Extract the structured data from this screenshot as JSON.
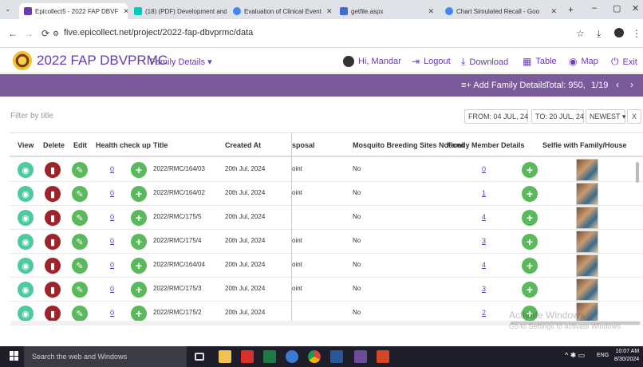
{
  "browser": {
    "tabs": [
      {
        "label": "Epicollect5 - 2022 FAP DBVF",
        "color": "#6a3ab0",
        "active": true
      },
      {
        "label": "(18) (PDF) Development and",
        "color": "#00ccbb",
        "active": false
      },
      {
        "label": "Evaluation of Clinical Event",
        "color": "#4285f4",
        "active": false
      },
      {
        "label": "getfile.aspx",
        "color": "#3f6bd6",
        "active": false
      },
      {
        "label": "Chart Simulated Recall - Goo",
        "color": "#4285f4",
        "active": false
      }
    ],
    "new_tab": "+",
    "url": "five.epicollect.net/project/2022-fap-dbvprmc/data"
  },
  "header": {
    "title": "2022 FAP DBVPRMC",
    "subtitle": "Family Details ▾",
    "greeting": "Hi, Mandar",
    "logout": "Logout",
    "download": "Download",
    "table": "Table",
    "map": "Map",
    "exit": "Exit"
  },
  "toolbar": {
    "add_label": "Add Family Details",
    "total": "Total: 950,",
    "page": "1/19"
  },
  "filter": {
    "placeholder": "Filter by title",
    "from": "FROM: 04 JUL, 24",
    "to": "TO: 20 JUL, 24",
    "sort": "NEWEST ▾",
    "clear": "X"
  },
  "table": {
    "columns": {
      "view": "View",
      "delete": "Delete",
      "edit": "Edit",
      "health": "Health check up",
      "title": "Title",
      "created": "Created At",
      "disposal": "sposal",
      "mosquito": "Mosquito Breeding Sites Noticed",
      "family": "Family Member Details",
      "selfie": "Selfie with Family/House"
    },
    "rows": [
      {
        "health": "0",
        "title": "2022/RMC/164/03",
        "created": "20th Jul, 2024",
        "disposal": "oint",
        "mosquito": "No",
        "family": "0"
      },
      {
        "health": "0",
        "title": "2022/RMC/164/02",
        "created": "20th Jul, 2024",
        "disposal": "oint",
        "mosquito": "No",
        "family": "1"
      },
      {
        "health": "0",
        "title": "2022/RMC/175/5",
        "created": "20th Jul, 2024",
        "disposal": "",
        "mosquito": "No",
        "family": "4"
      },
      {
        "health": "0",
        "title": "2022/RMC/175/4",
        "created": "20th Jul, 2024",
        "disposal": "oint",
        "mosquito": "No",
        "family": "3"
      },
      {
        "health": "0",
        "title": "2022/RMC/164/04",
        "created": "20th Jul, 2024",
        "disposal": "oint",
        "mosquito": "No",
        "family": "4"
      },
      {
        "health": "0",
        "title": "2022/RMC/175/3",
        "created": "20th Jul, 2024",
        "disposal": "oint",
        "mosquito": "No",
        "family": "3"
      },
      {
        "health": "0",
        "title": "2022/RMC/175/2",
        "created": "20th Jul, 2024",
        "disposal": "",
        "mosquito": "No",
        "family": "2"
      }
    ]
  },
  "watermark": {
    "line1": "Activate Windows",
    "line2": "Go to Settings to activate Windows."
  },
  "taskbar": {
    "search": "Search the web and Windows",
    "lang": "ENG",
    "time": "10:07 AM",
    "date": "8/30/2024"
  },
  "icons": {
    "view": "eye-icon",
    "delete": "trash-icon",
    "edit": "pencil-icon",
    "add": "plus-icon"
  }
}
